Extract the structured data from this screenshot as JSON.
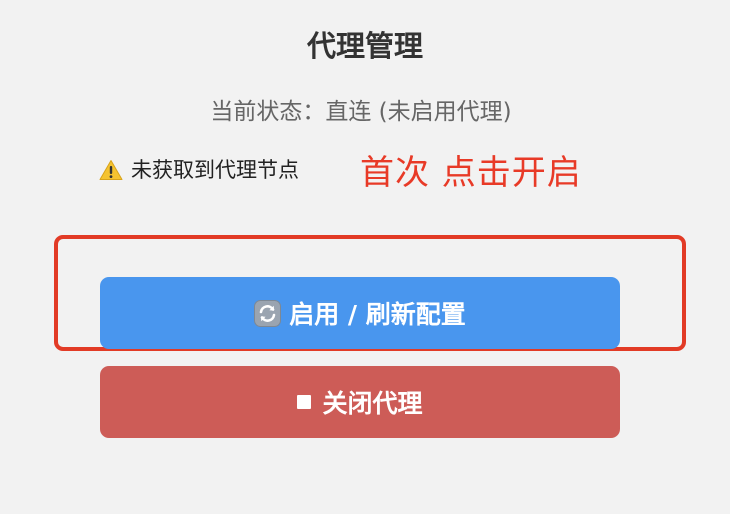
{
  "page": {
    "title": "代理管理",
    "status_text": "当前状态：直连 (未启用代理)",
    "warning": {
      "icon": "warning-icon",
      "text": "未获取到代理节点"
    },
    "annotation": "首次 点击开启"
  },
  "buttons": {
    "enable": {
      "icon": "refresh-icon",
      "label": "启用 / 刷新配置"
    },
    "disable": {
      "icon": "stop-icon",
      "label": "关闭代理"
    }
  },
  "colors": {
    "background": "#f2f2f2",
    "primary": "#4996ee",
    "danger": "#cd5c57",
    "annotation_red": "#e83a27",
    "warning_yellow": "#f5c330"
  }
}
